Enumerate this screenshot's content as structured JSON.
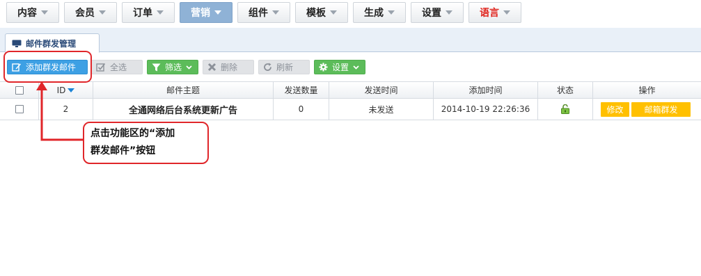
{
  "nav": {
    "items": [
      {
        "label": "内容"
      },
      {
        "label": "会员"
      },
      {
        "label": "订单"
      },
      {
        "label": "营销"
      },
      {
        "label": "组件"
      },
      {
        "label": "模板"
      },
      {
        "label": "生成"
      },
      {
        "label": "设置"
      },
      {
        "label": "语言"
      }
    ],
    "active_index": 3,
    "language_color": "#e0231c"
  },
  "tab": {
    "label": "邮件群发管理"
  },
  "toolbar": {
    "add_label": "添加群发邮件",
    "select_all_label": "全选",
    "filter_label": "筛选",
    "delete_label": "删除",
    "refresh_label": "刷新",
    "settings_label": "设置"
  },
  "table": {
    "headers": [
      "",
      "ID",
      "邮件主题",
      "发送数量",
      "发送时间",
      "添加时间",
      "状态",
      "操作"
    ],
    "rows": [
      {
        "id": "2",
        "subject": "全通网络后台系统更新广告",
        "send_count": "0",
        "send_time": "未发送",
        "add_time": "2014-10-19 22:26:36",
        "status_icon": "unlock-icon",
        "edit_label": "修改",
        "send_label": "邮箱群发"
      }
    ]
  },
  "annotation": {
    "callout_line1": "点击功能区的“添加",
    "callout_line2": "群发邮件”按钮"
  },
  "colors": {
    "accent_blue": "#3da0e4",
    "active_nav": "#8fb2d6",
    "action_yellow": "#ffc000",
    "annotation_red": "#e0262a",
    "filter_green": "#5cbc5a"
  }
}
